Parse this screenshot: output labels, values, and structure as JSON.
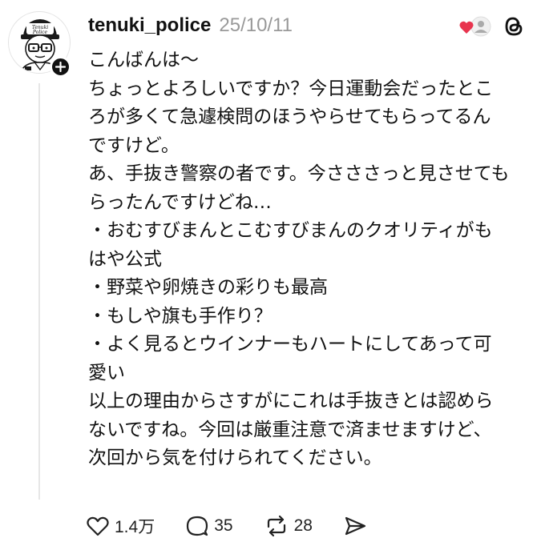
{
  "post": {
    "username": "tenuki_police",
    "date": "25/10/11",
    "avatar": {
      "cap_text_line1": "Tenuki",
      "cap_text_line2": "Police"
    },
    "lines": [
      "こんばんは〜",
      "ちょっとよろしいですか？今日運動会だったとこ",
      "ろが多くて急遽検問のほうやらせてもらってるん",
      "ですけど。",
      "あ、手抜き警察の者です。今さささっと見させても",
      "らったんですけどね…",
      "・おむすびまんとこむすびまんのクオリティがも",
      "はや公式",
      "・野菜や卵焼きの彩りも最高",
      "・もしや旗も手作り？",
      "・よく見るとウインナーもハートにしてあって可",
      "愛い",
      "以上の理由からさすがにこれは手抜きとは認めら",
      "ないですね。今回は厳重注意で済ませますけど、",
      "次回から気を付けられてください。"
    ],
    "actions": {
      "like_count": "1.4万",
      "reply_count": "35",
      "repost_count": "28"
    }
  },
  "icons": {
    "follow": "plus-icon",
    "liked_by": "heart-user-icon",
    "app": "threads-logo-icon",
    "like": "heart-icon",
    "reply": "comment-bubble-icon",
    "repost": "repost-icon",
    "share": "send-icon"
  },
  "colors": {
    "text": "#111111",
    "muted": "#999999",
    "heart_red": "#e8344e",
    "line": "#e6e6e6"
  }
}
